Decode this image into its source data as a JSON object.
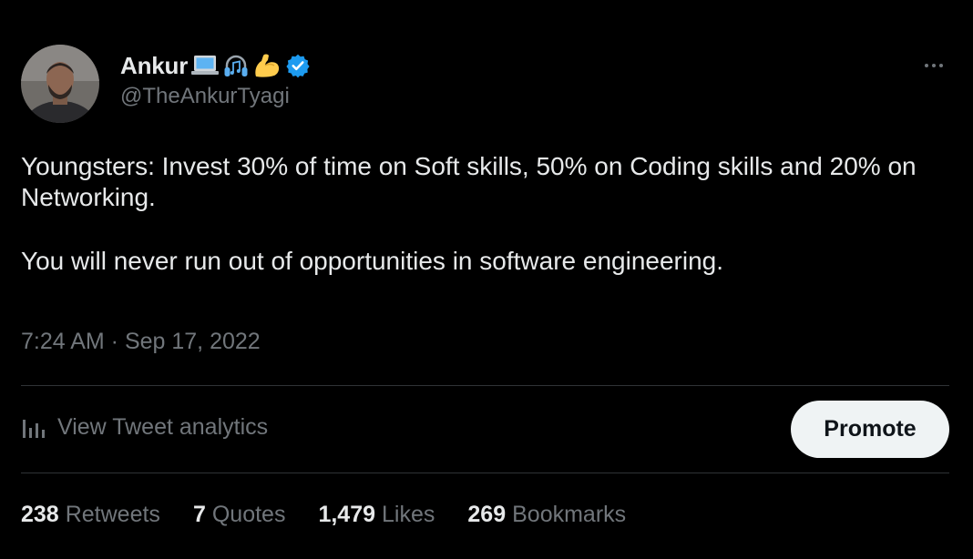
{
  "author": {
    "display_name": "Ankur",
    "handle": "@TheAnkurTyagi",
    "emojis": [
      "laptop-icon",
      "headphones-icon",
      "flexed-biceps-icon"
    ],
    "verified": true
  },
  "tweet": {
    "paragraphs": [
      "Youngsters: Invest 30% of time on Soft skills, 50% on Coding skills and 20% on Networking.",
      "You will never run out of opportunities in software engineering."
    ],
    "timestamp": "7:24 AM · Sep 17, 2022"
  },
  "actions": {
    "analytics_label": "View Tweet analytics",
    "promote_label": "Promote"
  },
  "stats": [
    {
      "count": "238",
      "label": "Retweets"
    },
    {
      "count": "7",
      "label": "Quotes"
    },
    {
      "count": "1,479",
      "label": "Likes"
    },
    {
      "count": "269",
      "label": "Bookmarks"
    }
  ],
  "colors": {
    "background": "#000000",
    "text_primary": "#e7e9ea",
    "text_secondary": "#71767b",
    "divider": "#2f3336",
    "verified_blue": "#1d9bf0",
    "promote_bg": "#eff3f4"
  }
}
